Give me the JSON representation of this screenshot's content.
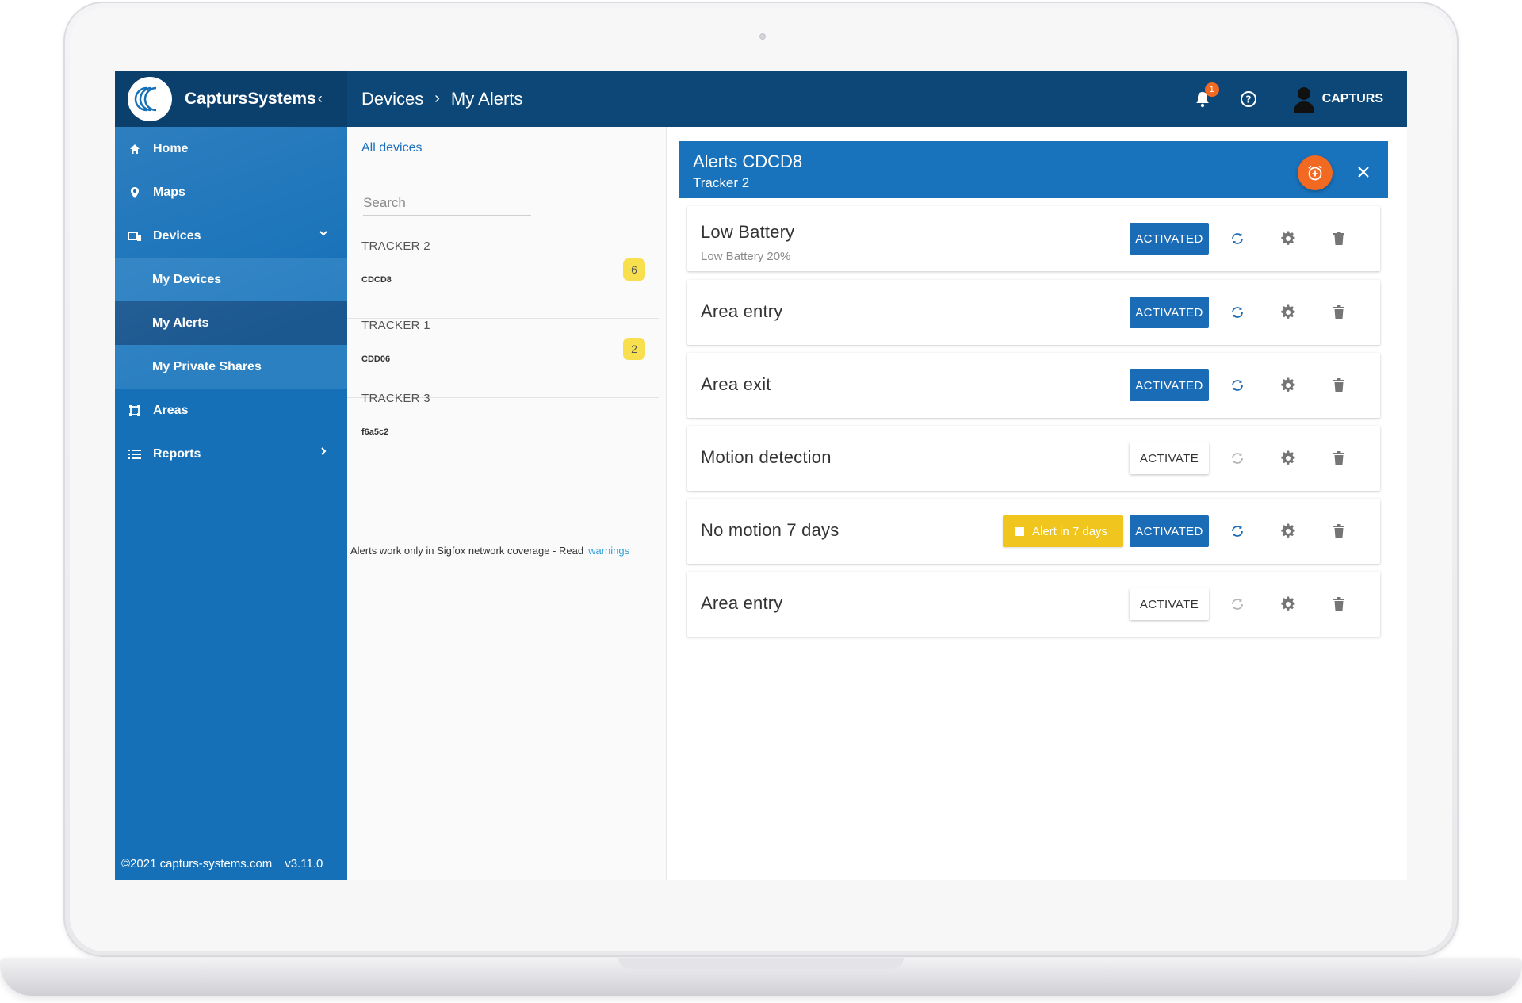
{
  "app": {
    "brand_name": "CaptursSystems",
    "brand_collapse_icon": "chevron-left-icon"
  },
  "breadcrumb": {
    "items": [
      "Devices",
      "My Alerts"
    ]
  },
  "topbar": {
    "notification_count": "1",
    "user_name": "CAPTURS"
  },
  "sidebar": {
    "items": [
      {
        "label": "Home",
        "icon": "home-icon"
      },
      {
        "label": "Maps",
        "icon": "map-pin-icon"
      },
      {
        "label": "Devices",
        "icon": "devices-icon"
      },
      {
        "label": "My Devices"
      },
      {
        "label": "My Alerts"
      },
      {
        "label": "My Private Shares"
      },
      {
        "label": "Areas",
        "icon": "area-icon"
      },
      {
        "label": "Reports",
        "icon": "list-icon"
      }
    ],
    "footer_copyright": "©2021 capturs-systems.com",
    "footer_version": "v3.11.0"
  },
  "devices_panel": {
    "all_devices_label": "All devices",
    "search_placeholder": "Search",
    "trackers": [
      {
        "name": "TRACKER 2",
        "id": "CDCD8",
        "alert_count": "6"
      },
      {
        "name": "TRACKER 1",
        "id": "CDD06",
        "alert_count": "2"
      },
      {
        "name": "TRACKER 3",
        "id": "f6a5c2",
        "alert_count": ""
      }
    ],
    "coverage_note": "Alerts work only in Sigfox network coverage - Read",
    "coverage_link": "warnings"
  },
  "alerts_panel": {
    "title": "Alerts CDCD8",
    "subtitle": "Tracker 2",
    "alerts": [
      {
        "title": "Low Battery",
        "subtitle": "Low Battery 20%",
        "status": "ACTIVATED",
        "active": true
      },
      {
        "title": "Area entry",
        "subtitle": "",
        "status": "ACTIVATED",
        "active": true
      },
      {
        "title": "Area exit",
        "subtitle": "",
        "status": "ACTIVATED",
        "active": true
      },
      {
        "title": "Motion detection",
        "subtitle": "",
        "status": "ACTIVATE",
        "active": false
      },
      {
        "title": "No motion 7 days",
        "subtitle": "",
        "status": "ACTIVATED",
        "active": true,
        "countdown": "Alert in 7 days"
      },
      {
        "title": "Area entry",
        "subtitle": "",
        "status": "ACTIVATE",
        "active": false
      }
    ]
  },
  "colors": {
    "topbar": "#0d4778",
    "sidebar": "#1570b8",
    "accent_orange": "#f26a21",
    "badge_yellow": "#f8df4d",
    "activated_blue": "#1b6cb6"
  }
}
